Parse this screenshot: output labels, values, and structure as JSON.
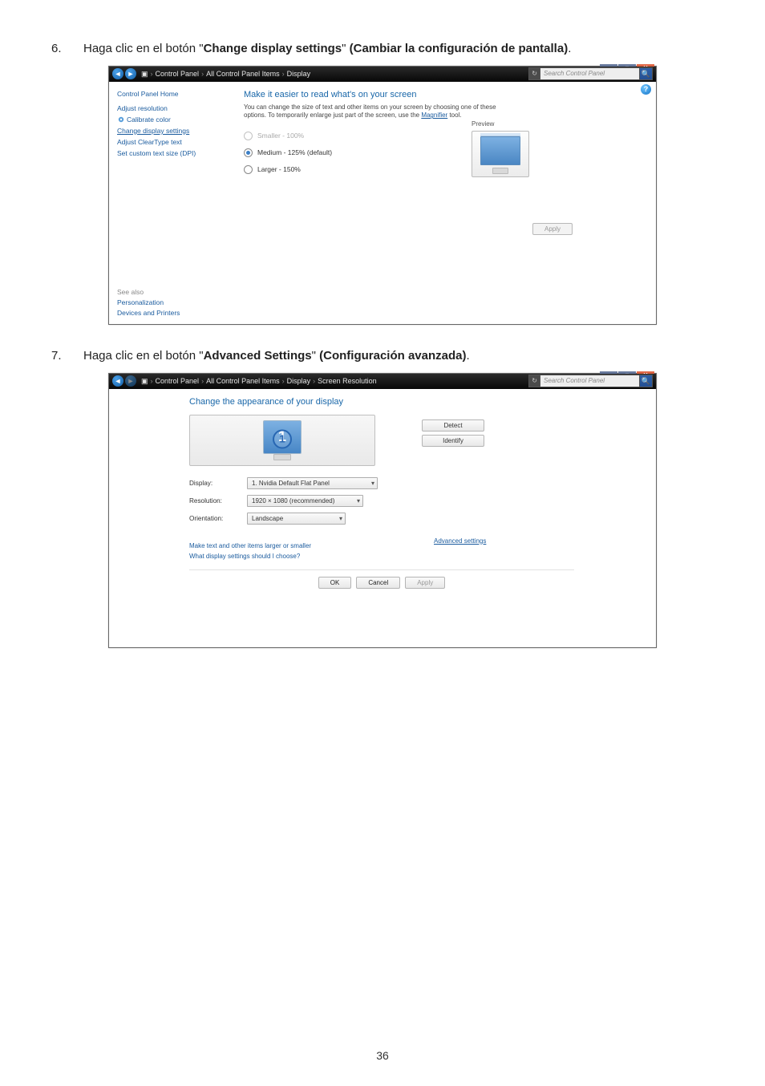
{
  "step6": {
    "num": "6.",
    "text_pre": "Haga clic en el botón \"",
    "bold": "Change display settings",
    "text_mid": "\" ",
    "paren": "(Cambiar la configuración de pantalla)",
    "tail": "."
  },
  "step7": {
    "num": "7.",
    "text_pre": "Haga clic en el botón \"",
    "bold": "Advanced Settings",
    "text_mid": "\" ",
    "paren": "(Configuración avanzada)",
    "tail": "."
  },
  "win1": {
    "crumbs": [
      "Control Panel",
      "All Control Panel Items",
      "Display"
    ],
    "search_placeholder": "Search Control Panel",
    "side": {
      "home": "Control Panel Home",
      "links": [
        "Adjust resolution",
        "Calibrate color",
        "Change display settings",
        "Adjust ClearType text",
        "Set custom text size (DPI)"
      ],
      "seealso_hdr": "See also",
      "seealso": [
        "Personalization",
        "Devices and Printers"
      ]
    },
    "main": {
      "heading": "Make it easier to read what's on your screen",
      "desc_pre": "You can change the size of text and other items on your screen by choosing one of these options. To temporarily enlarge just part of the screen, use the ",
      "desc_link": "Magnifier",
      "desc_post": " tool.",
      "radios": [
        "Smaller - 100%",
        "Medium - 125% (default)",
        "Larger - 150%"
      ],
      "preview_label": "Preview",
      "apply": "Apply"
    }
  },
  "win2": {
    "crumbs": [
      "Control Panel",
      "All Control Panel Items",
      "Display",
      "Screen Resolution"
    ],
    "search_placeholder": "Search Control Panel",
    "heading": "Change the appearance of your display",
    "detect": "Detect",
    "identify": "Identify",
    "monitor_number": "1",
    "fields": {
      "display_label": "Display:",
      "display_val": "1. Nvidia Default Flat Panel",
      "res_label": "Resolution:",
      "res_val": "1920 × 1080 (recommended)",
      "orient_label": "Orientation:",
      "orient_val": "Landscape"
    },
    "adv": "Advanced settings",
    "link1": "Make text and other items larger or smaller",
    "link2": "What display settings should I choose?",
    "ok": "OK",
    "cancel": "Cancel",
    "apply": "Apply"
  },
  "page_number": "36",
  "wctrl": {
    "min": "—",
    "max": "▢",
    "close": "X"
  },
  "refresh": "↻"
}
